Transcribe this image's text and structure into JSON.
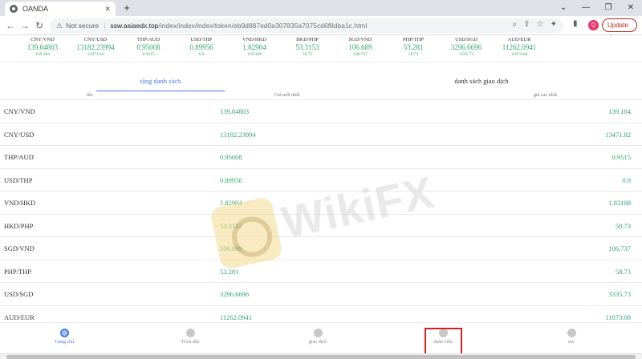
{
  "browser": {
    "tab_title": "OANDA",
    "tab_close": "✕",
    "new_tab": "+",
    "minimize": "—",
    "restore": "❐",
    "close": "✕",
    "back": "←",
    "forward": "→",
    "reload": "↻",
    "security_icon": "⚠",
    "not_secure_label": "Not secure",
    "separator": "|",
    "url_host": "ssw.asiaedx.top",
    "url_path": "/index/index/index/token/eb9d887ed0a307835a7075cd6f8dba1c.html",
    "profile_initial": "Q",
    "update_label": "Update",
    "update_more": "⋮"
  },
  "ticker": [
    {
      "pair": "CNY/VND",
      "price": "139.04803",
      "sub": "139.184"
    },
    {
      "pair": "CNY/USD",
      "price": "13182.23994",
      "sub": "13471.82"
    },
    {
      "pair": "THP/AUD",
      "price": "0.95008",
      "sub": "0.9515"
    },
    {
      "pair": "USD/THP",
      "price": "0.89956",
      "sub": "0.9"
    },
    {
      "pair": "VND/HKD",
      "price": "1.82904",
      "sub": "1.83108"
    },
    {
      "pair": "HKD/PHP",
      "price": "53.3153",
      "sub": "58.73"
    },
    {
      "pair": "SGD/VND",
      "price": "106.689",
      "sub": "106.737"
    },
    {
      "pair": "PHP/THP",
      "price": "53.281",
      "sub": "58.73"
    },
    {
      "pair": "USD/SGD",
      "price": "3296.6696",
      "sub": "3335.73"
    },
    {
      "pair": "AUD/EUR",
      "price": "11262.0941",
      "sub": "11873.08"
    }
  ],
  "tabs": {
    "market": "tăng danh sách",
    "transactions": "danh sách giao dịch"
  },
  "columns": {
    "name": "tên",
    "latest": "Giá mới nhất",
    "high": "giá cao nhất"
  },
  "rows": [
    {
      "pair": "CNY/VND",
      "price": "139.04803",
      "high": "139.184"
    },
    {
      "pair": "CNY/USD",
      "price": "13182.23994",
      "high": "13471.82"
    },
    {
      "pair": "THP/AUD",
      "price": "0.95008",
      "high": "0.9515"
    },
    {
      "pair": "USD/THP",
      "price": "0.89956",
      "high": "0.9"
    },
    {
      "pair": "VND/HKD",
      "price": "1.82904",
      "high": "1.83108"
    },
    {
      "pair": "HKD/PHP",
      "price": "53.3153",
      "high": "58.73"
    },
    {
      "pair": "SGD/VND",
      "price": "106.689",
      "high": "106.737"
    },
    {
      "pair": "PHP/THP",
      "price": "53.281",
      "high": "58.73"
    },
    {
      "pair": "USD/SGD",
      "price": "3296.6696",
      "high": "3335.73"
    },
    {
      "pair": "AUD/EUR",
      "price": "11262.0941",
      "high": "11873.08"
    }
  ],
  "watermark": {
    "text": "WikiFX"
  },
  "bottom_nav": [
    {
      "label": "Trang chủ",
      "icon": "home-icon"
    },
    {
      "label": "Trích dẫn",
      "icon": "quote-icon"
    },
    {
      "label": "giao dịch",
      "icon": "trade-icon"
    },
    {
      "label": "nhân viên",
      "icon": "wallet-icon"
    },
    {
      "label": "my",
      "icon": "user-icon"
    }
  ],
  "colors": {
    "up_green": "#2fa56c",
    "accent_blue": "#4a7be8",
    "highlight_red": "#d91e1e"
  }
}
